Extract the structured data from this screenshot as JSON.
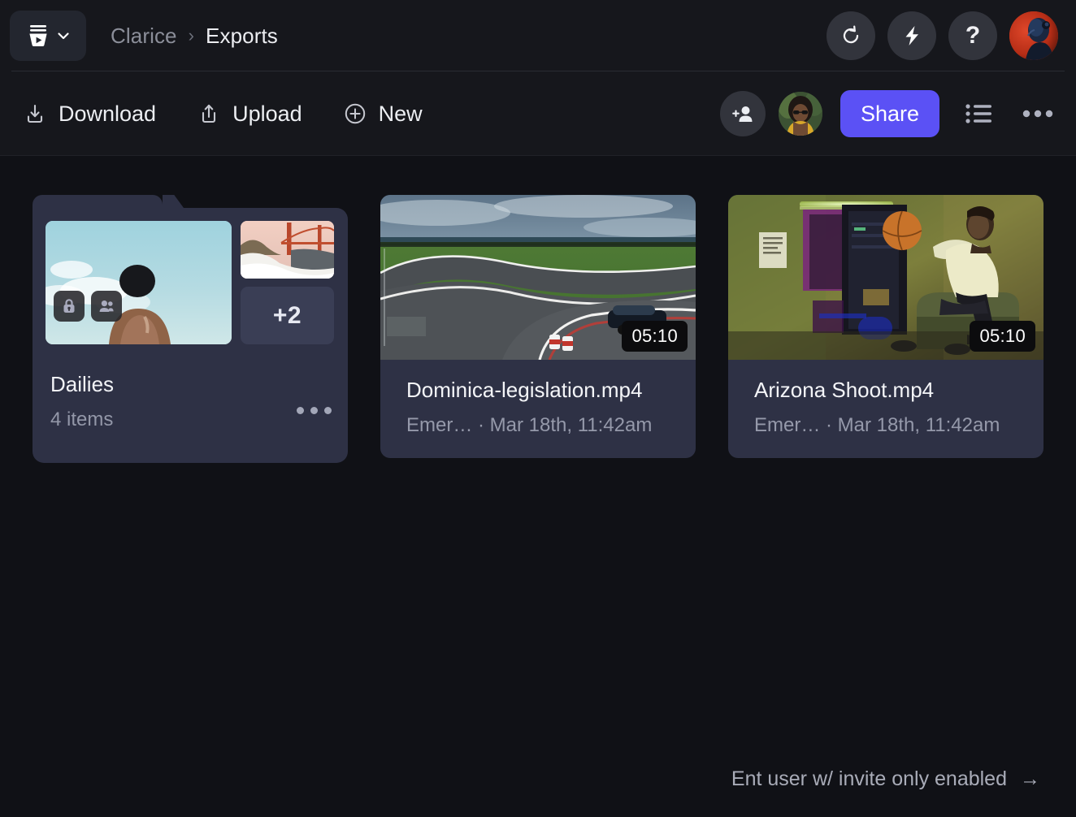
{
  "app": {
    "logo_icon": "frame-logo-icon",
    "dropdown_icon": "chevron-down-icon"
  },
  "breadcrumb": {
    "root": "Clarice",
    "separator": "›",
    "current": "Exports"
  },
  "header_actions": [
    {
      "name": "refresh-button",
      "icon": "refresh-icon",
      "label": ""
    },
    {
      "name": "lightning-button",
      "icon": "lightning-bolt-icon",
      "label": ""
    },
    {
      "name": "help-button",
      "icon": "question-mark-icon",
      "label": "?"
    }
  ],
  "account": {
    "avatar_name": "user-avatar",
    "avatar_alt": "Account avatar"
  },
  "toolbar": {
    "download_label": "Download",
    "upload_label": "Upload",
    "new_label": "New",
    "share_label": "Share",
    "invite_icon": "add-person-icon",
    "collaborator_avatar": "collaborator-avatar",
    "list_view_icon": "list-view-icon",
    "more_icon": "more-options-icon"
  },
  "folder": {
    "title": "Dailies",
    "item_count": "4 items",
    "overflow_count": "+2",
    "badges": [
      "lock-icon",
      "people-icon"
    ],
    "more_icon": "more-options-icon"
  },
  "files": [
    {
      "title": "Dominica-legislation.mp4",
      "owner": "Emer…",
      "separator": "·",
      "date": "Mar 18th, 11:42am",
      "duration": "05:10",
      "subtitle": "Emer… · Mar 18th, 11:42am",
      "thumb": "race-track-car"
    },
    {
      "title": "Arizona Shoot.mp4",
      "owner": "Emer…",
      "separator": "·",
      "date": "Mar 18th, 11:42am",
      "duration": "05:10",
      "subtitle": "Emer… · Mar 18th, 11:42am",
      "thumb": "neon-basketball"
    }
  ],
  "footer": {
    "hint": "Ent user w/ invite only enabled",
    "arrow": "→"
  },
  "colors": {
    "accent": "#5b51f5",
    "card": "#2e3145",
    "page_bg": "#101116",
    "chrome_bg": "#16171c"
  }
}
